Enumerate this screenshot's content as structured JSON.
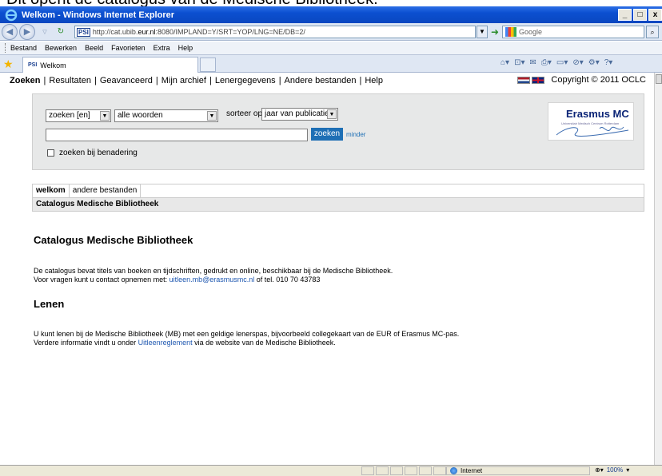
{
  "caption": "Dit opent de catalogus van de Medische Bibliotheek.",
  "window": {
    "title": "Welkom - Windows Internet Explorer",
    "minimize": "_",
    "maximize": "□",
    "close": "x"
  },
  "address": {
    "badge": "PSI",
    "url_prefix": "http://cat.ubib.",
    "url_host": "eur.nl",
    "url_rest": ":8080/IMPLAND=Y/SRT=YOP/LNG=NE/DB=2/",
    "search_engine": "Google"
  },
  "menu": {
    "items": [
      "Bestand",
      "Bewerken",
      "Beeld",
      "Favorieten",
      "Extra",
      "Help"
    ]
  },
  "tab": {
    "badge": "PSI",
    "title": "Welkom"
  },
  "page": {
    "nav": [
      {
        "label": "Zoeken",
        "active": true
      },
      {
        "label": "Resultaten"
      },
      {
        "label": "Geavanceerd"
      },
      {
        "label": "Mijn archief"
      },
      {
        "label": "Lenergegevens"
      },
      {
        "label": "Andere bestanden"
      },
      {
        "label": "Help"
      }
    ],
    "copyright": "Copyright © 2011 OCLC",
    "search": {
      "field_select": "zoeken [en]",
      "words_select": "alle woorden",
      "sort_label": "sorteer op",
      "sort_select": "jaar van publicatie",
      "query": "",
      "button": "zoeken",
      "less_link": "minder",
      "approx_label": "zoeken bij benadering"
    },
    "logo": {
      "brand": "Erasmus MC",
      "tagline": "Universitair Medisch Centrum Rotterdam"
    },
    "tabs": [
      "welkom",
      "andere bestanden"
    ],
    "subbar": "Catalogus Medische Bibliotheek",
    "heading1": "Catalogus Medische Bibliotheek",
    "para1_line1": "De catalogus bevat titels van boeken en tijdschriften, gedrukt en online, beschikbaar bij de Medische Bibliotheek.",
    "para1_line2_pre": "Voor vragen kunt u contact opnemen met: ",
    "para1_email": "uitleen.mb@erasmusmc.nl",
    "para1_line2_post": " of tel. 010 70 43783",
    "heading2": "Lenen",
    "para2_line1": "U kunt lenen bij de Medische Bibliotheek (MB) met een geldige lenerspas, bijvoorbeeld collegekaart van de EUR of Erasmus MC-pas.",
    "para2_line2_pre": "Verdere informatie vindt u onder ",
    "para2_link": "Uitleenreglement",
    "para2_line2_post": " via de website van de Medische Bibliotheek."
  },
  "status": {
    "zone": "Internet",
    "zoom": "100%"
  }
}
